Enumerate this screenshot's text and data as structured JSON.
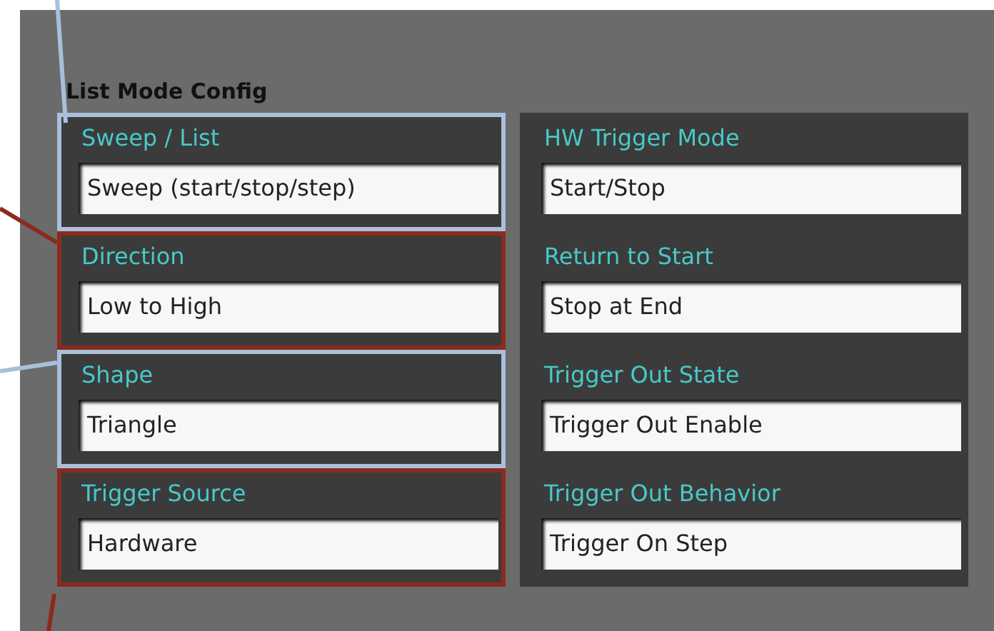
{
  "panel": {
    "title": "List Mode Config"
  },
  "left_controls": [
    {
      "label": "Sweep / List",
      "value": "Sweep (start/stop/step)",
      "color": "#a9bfdc"
    },
    {
      "label": "Direction",
      "value": "Low to High",
      "color": "#8b2a1e"
    },
    {
      "label": "Shape",
      "value": "Triangle",
      "color": "#a9bfdc"
    },
    {
      "label": "Trigger Source",
      "value": "Hardware",
      "color": "#8b2a1e"
    }
  ],
  "right_controls": [
    {
      "label": "HW Trigger Mode",
      "value": "Start/Stop"
    },
    {
      "label": "Return to Start",
      "value": "Stop at End"
    },
    {
      "label": "Trigger Out State",
      "value": "Trigger Out Enable"
    },
    {
      "label": "Trigger Out Behavior",
      "value": "Trigger On Step"
    }
  ]
}
